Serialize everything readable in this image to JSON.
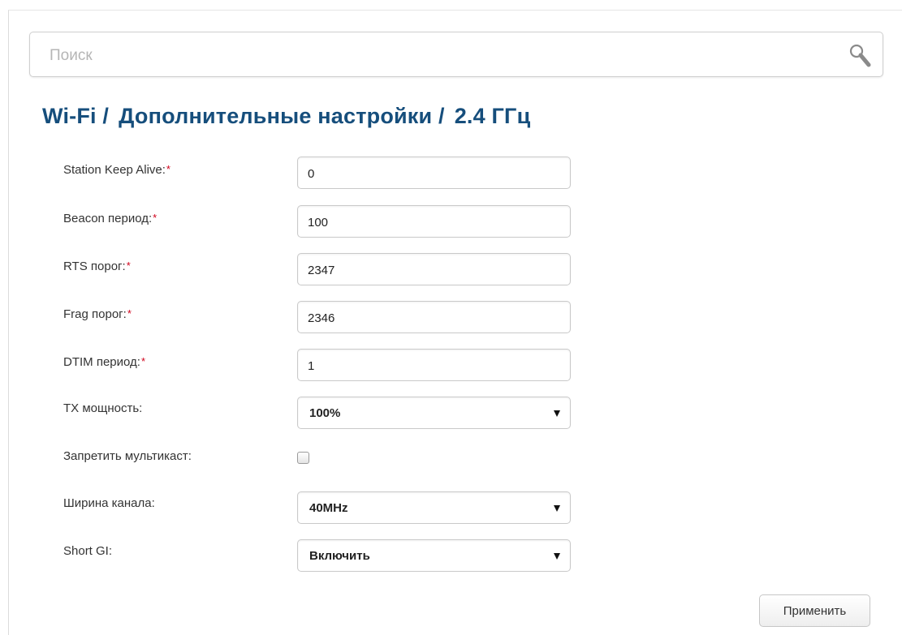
{
  "search": {
    "placeholder": "Поиск",
    "icon": "search-icon"
  },
  "title": {
    "part1": "Wi-Fi /",
    "part2": "Дополнительные настройки /",
    "part3": "2.4 ГГц",
    "color": "#164e7c"
  },
  "required_marker": "*",
  "fields": {
    "station_keep_alive": {
      "label": "Station Keep Alive:",
      "value": "0"
    },
    "beacon_period": {
      "label": "Beacon период:",
      "value": "100"
    },
    "rts_threshold": {
      "label": "RTS порог:",
      "value": "2347"
    },
    "frag_threshold": {
      "label": "Frag порог:",
      "value": "2346"
    },
    "dtim_period": {
      "label": "DTIM период:",
      "value": "1"
    },
    "tx_power": {
      "label": "TX мощность:",
      "selected": "100%"
    },
    "disable_multicast": {
      "label": "Запретить мультикаст:",
      "checked": false
    },
    "channel_width": {
      "label": "Ширина канала:",
      "selected": "40MHz"
    },
    "short_gi": {
      "label": "Short GI:",
      "selected": "Включить"
    }
  },
  "apply_button": {
    "label": "Применить"
  }
}
